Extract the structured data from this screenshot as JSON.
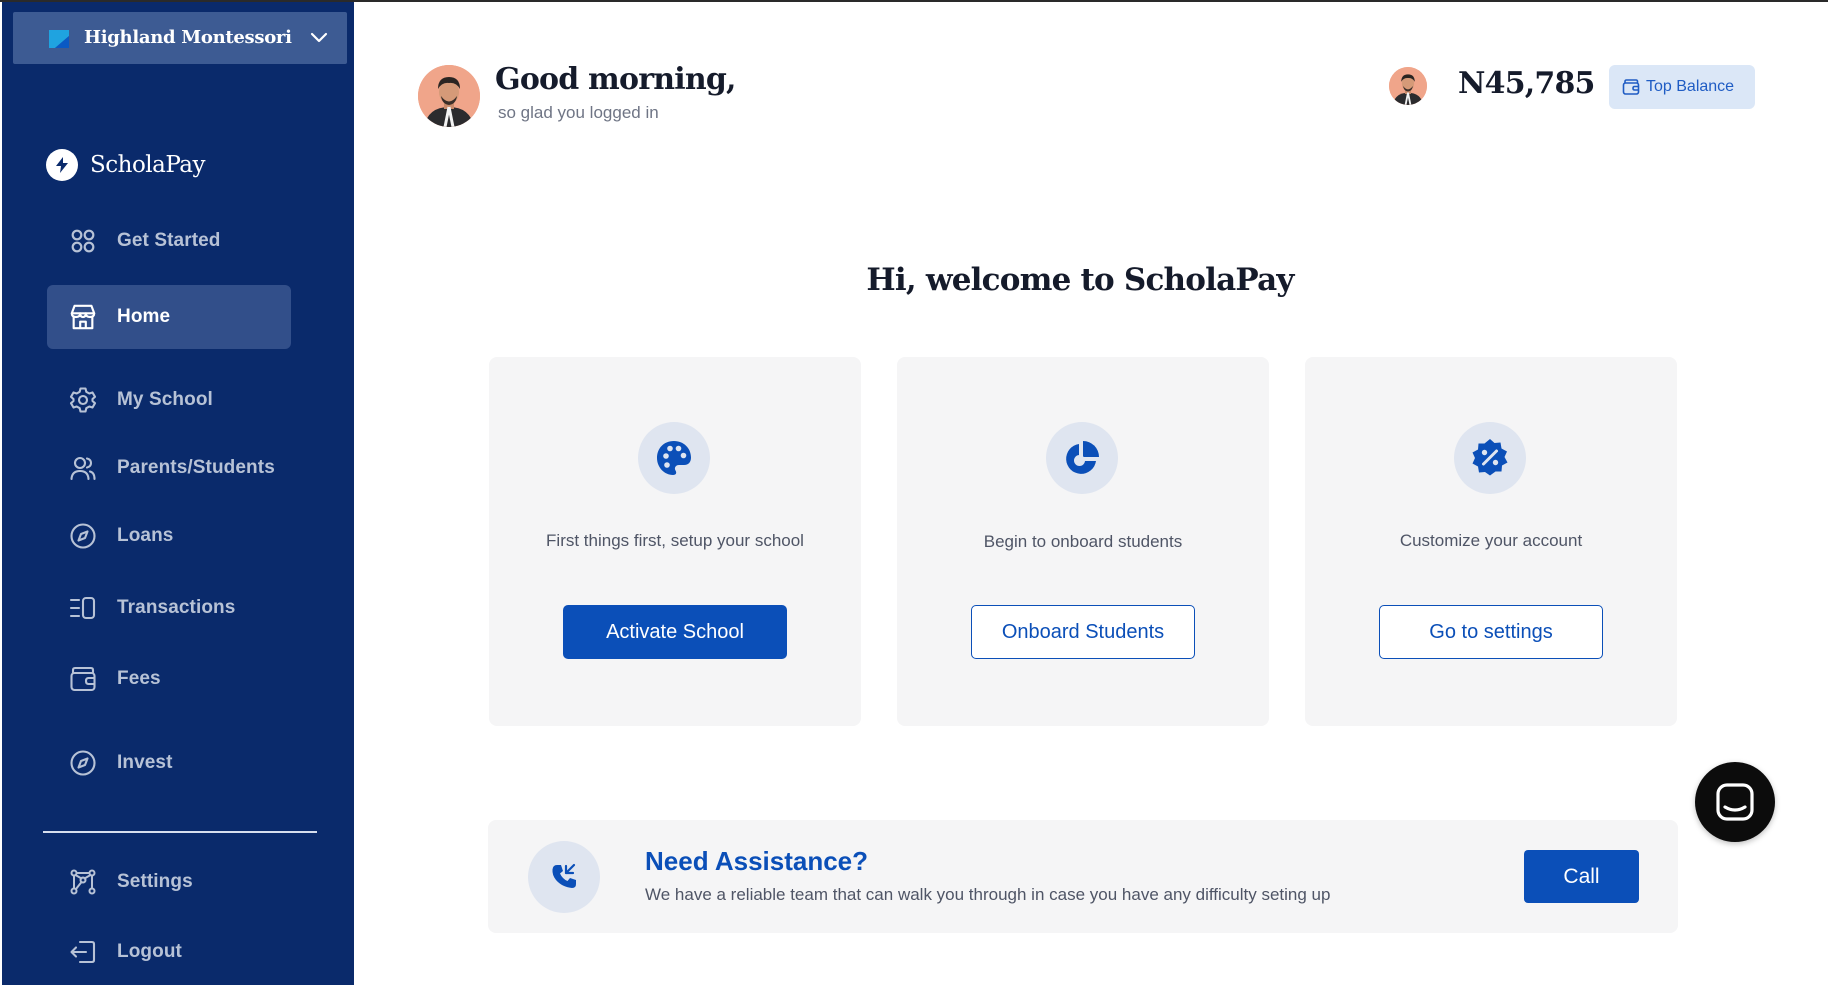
{
  "org_switcher": {
    "name": "Highland Montessori"
  },
  "brand": {
    "name": "ScholaPay"
  },
  "sidebar": {
    "items": [
      {
        "label": "Get Started",
        "icon": "grid-icon",
        "active": false
      },
      {
        "label": "Home",
        "icon": "store-icon",
        "active": true
      },
      {
        "label": "My School",
        "icon": "gear-icon",
        "active": false
      },
      {
        "label": "Parents/Students",
        "icon": "users-icon",
        "active": false
      },
      {
        "label": "Loans",
        "icon": "compass-icon",
        "active": false
      },
      {
        "label": "Transactions",
        "icon": "list-icon",
        "active": false
      },
      {
        "label": "Fees",
        "icon": "wallet-icon",
        "active": false
      },
      {
        "label": "Invest",
        "icon": "compass-icon",
        "active": false
      }
    ],
    "bottom_items": [
      {
        "label": "Settings",
        "icon": "nodes-icon"
      },
      {
        "label": "Logout",
        "icon": "logout-icon"
      }
    ]
  },
  "header": {
    "greeting": "Good morning,",
    "subtitle": "so glad you logged in",
    "balance": "N45,785",
    "topup_label": "Top Balance"
  },
  "main": {
    "welcome": "Hi, welcome to ScholaPay",
    "cards": [
      {
        "text": "First things first, setup your school",
        "button": "Activate School",
        "icon": "palette-icon"
      },
      {
        "text": "Begin to onboard students",
        "button": "Onboard Students",
        "icon": "pie-chart-icon"
      },
      {
        "text": "Customize your account",
        "button": "Go to settings",
        "icon": "discount-badge-icon"
      }
    ]
  },
  "assist": {
    "title": "Need Assistance?",
    "text": "We have a reliable team that can walk you through in case you have any difficulty seting up",
    "button": "Call"
  },
  "colors": {
    "sidebar_bg": "#0a2a6b",
    "accent": "#0b4fb8",
    "card_bg": "#f5f5f6"
  }
}
